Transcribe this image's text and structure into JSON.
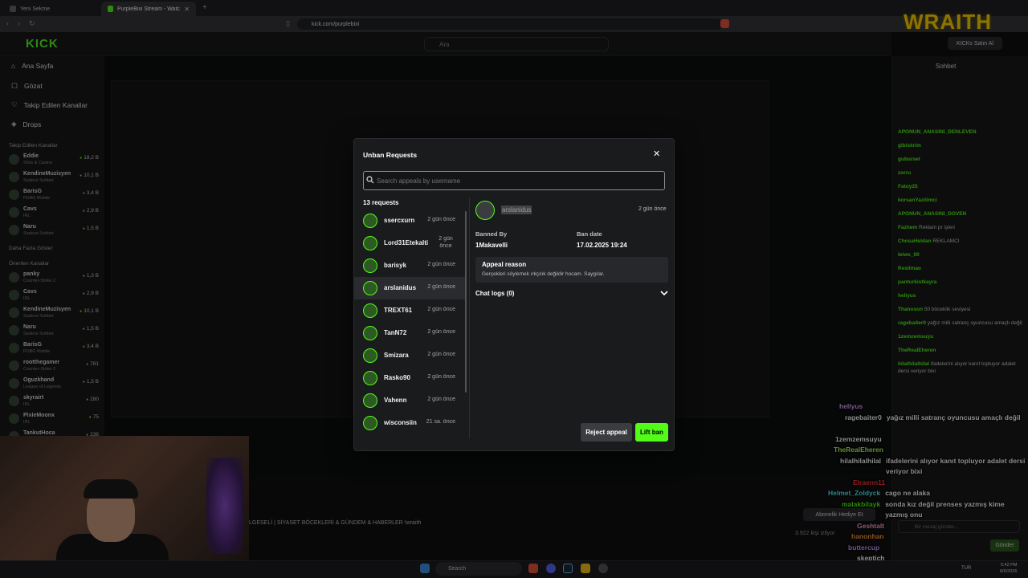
{
  "browser": {
    "tabs": [
      {
        "label": "Yeni Sekme"
      },
      {
        "label": "PurpleBixi Stream - Watch Live o"
      }
    ],
    "url": "kick.com/purplebixi"
  },
  "kick": {
    "logo": "KICK",
    "search_placeholder": "Ara",
    "nav": [
      {
        "label": "Ana Sayfa"
      },
      {
        "label": "Gözat"
      },
      {
        "label": "Takip Edilen Kanallar"
      },
      {
        "label": "Drops"
      }
    ],
    "followed_title": "Takip Edilen Kanallar",
    "followed": [
      {
        "name": "Eddie",
        "sub": "Slots & Casino",
        "viewers": "18,2 B"
      },
      {
        "name": "KendineMuzisyen",
        "sub": "Sadece Sohbet",
        "viewers": "10,1 B"
      },
      {
        "name": "BarisG",
        "sub": "PUBG Mobile",
        "viewers": "3,4 B"
      },
      {
        "name": "Cavs",
        "sub": "IRL",
        "viewers": "2,9 B"
      },
      {
        "name": "Naru",
        "sub": "Sadece Sohbet",
        "viewers": "1,5 B"
      }
    ],
    "show_more": "Daha Fazla Göster",
    "recommended_title": "Önerilen Kanallar",
    "recommended": [
      {
        "name": "panky",
        "sub": "Counter-Strike 2",
        "viewers": "1,3 B"
      },
      {
        "name": "Cavs",
        "sub": "IRL",
        "viewers": "2,9 B"
      },
      {
        "name": "KendineMuzisyen",
        "sub": "Sadece Sohbet",
        "viewers": "10,1 B"
      },
      {
        "name": "Naru",
        "sub": "Sadece Sohbet",
        "viewers": "1,5 B"
      },
      {
        "name": "BarisG",
        "sub": "PUBG Mobile",
        "viewers": "3,4 B"
      },
      {
        "name": "rootthegamer",
        "sub": "Counter-Strike 2",
        "viewers": "781"
      },
      {
        "name": "Oguzkhand",
        "sub": "League of Legends",
        "viewers": "1,5 B"
      },
      {
        "name": "skyrairt",
        "sub": "IRL",
        "viewers": "280"
      },
      {
        "name": "PixieMoonx",
        "sub": "IRL",
        "viewers": "75"
      },
      {
        "name": "TankutHoca",
        "sub": "",
        "viewers": "236"
      }
    ],
    "stream_title": "LGESELİ | SİYASET BÖCEKLERİ & GÜNDEM & HABERLER !wraith",
    "viewer_count": "3.922 kişi izliyor",
    "sub_gift": "Abonelik Hediye Et",
    "chat_title": "Sohbet",
    "chat_send": "Gönder",
    "chat_placeholder": "Bir mesaj gönder...",
    "kicks_btn": "KICKs Satın Al",
    "chat_messages": [
      {
        "user": "APONUN_ANASINI_DENLEVEN",
        "text": ""
      },
      {
        "user": "gibiskrim",
        "text": ""
      },
      {
        "user": "guburset",
        "text": ""
      },
      {
        "user": "zorru",
        "text": ""
      },
      {
        "user": "Fatoy25",
        "text": ""
      },
      {
        "user": "korsanYazilimci",
        "text": ""
      },
      {
        "user": "APONUN_ANASINI_DOVEN",
        "text": ""
      },
      {
        "user": "Fazhem",
        "text": "Reklam pr işleri"
      },
      {
        "user": "ChosaHeldan",
        "text": "REKLAMCI"
      },
      {
        "user": "leiws_00",
        "text": ""
      },
      {
        "user": "Reslimao",
        "text": ""
      },
      {
        "user": "panturkistkayra",
        "text": ""
      },
      {
        "user": "hellyus",
        "text": ""
      },
      {
        "user": "Thanoson",
        "text": "50 böceklik seviyesi"
      },
      {
        "user": "ragebaiter0",
        "text": "yağız milli satranç oyuncusu amaçlı değil"
      },
      {
        "user": "1zemzemsuyu",
        "text": ""
      },
      {
        "user": "TheRealEheren",
        "text": ""
      },
      {
        "user": "hilalhilalhilal",
        "text": "ifadelerini alıyor kanıt topluyor adalet dersi veriyor bixi"
      }
    ]
  },
  "overlay": {
    "brand": "WRAITH",
    "chat": [
      {
        "user": "hellyus",
        "text": "",
        "color": "#d9a6ff"
      },
      {
        "user": "ragebaiter0",
        "text": "yağız milli satranç oyuncusu amaçlı değil",
        "color": "#ffffff"
      },
      {
        "user": "1zemzemsuyu",
        "text": "",
        "color": "#ffffff"
      },
      {
        "user": "TheRealEheren",
        "text": "",
        "color": "#b6ff6a"
      },
      {
        "user": "hilalhilalhilal",
        "text": "ifadelerini alıyor kanıt topluyor adalet dersi veriyor bixi",
        "color": "#ffffff"
      },
      {
        "user": "Elraenn11",
        "text": "",
        "color": "#ff3b3b"
      },
      {
        "user": "Helmet_Zoldyck",
        "text": "cago ne alaka",
        "color": "#5cf0ff"
      },
      {
        "user": "malakbilayk",
        "text": "sonda kız değil prenses yazmış kime yazmış onu",
        "color": "#53fc18"
      },
      {
        "user": "Geshtalt",
        "text": "",
        "color": "#ffa6c9"
      },
      {
        "user": "hanonhan",
        "text": "",
        "color": "#ff9b3b"
      },
      {
        "user": "buttercup",
        "text": "",
        "color": "#c69bff"
      },
      {
        "user": "skeptich",
        "text": "",
        "color": "#ffffff"
      },
      {
        "user": "hellyus",
        "text": "",
        "color": "#d9a6ff"
      }
    ]
  },
  "modal": {
    "title": "Unban Requests",
    "search_placeholder": "Search appeals by username",
    "request_count": "13 requests",
    "requests": [
      {
        "username": "ssercxurn",
        "time": "2 gün önce"
      },
      {
        "username": "Lord31Etekalti",
        "time": "2 gün önce"
      },
      {
        "username": "barisyk",
        "time": "2 gün önce"
      },
      {
        "username": "arslanidus",
        "time": "2 gün önce"
      },
      {
        "username": "TREXT61",
        "time": "2 gün önce"
      },
      {
        "username": "TanN72",
        "time": "2 gün önce"
      },
      {
        "username": "Smizara",
        "time": "2 gün önce"
      },
      {
        "username": "Rasko90",
        "time": "2 gün önce"
      },
      {
        "username": "Vahenn",
        "time": "2 gün önce"
      },
      {
        "username": "wisconsiin",
        "time": "21 sa. önce"
      }
    ],
    "detail": {
      "username": "arslanidus",
      "time": "2 gün önce",
      "banned_by_label": "Banned By",
      "banned_by": "1Makavelli",
      "ban_date_label": "Ban date",
      "ban_date": "17.02.2025 19:24",
      "appeal_reason_label": "Appeal reason",
      "appeal_reason": "Gerçekleri söylemek ırkçılık değildir hocam. Saygılar.",
      "chat_logs": "Chat logs (0)"
    },
    "reject_label": "Reject appeal",
    "lift_label": "Lift ban"
  },
  "taskbar": {
    "search": "Search",
    "lang": "TUR",
    "time": "5:42 PM",
    "date": "8/6/2026"
  },
  "colors": {
    "kick_green": "#53fc18",
    "modal_bg": "#1a1b1d",
    "selected_row": "#2a2b2e"
  }
}
